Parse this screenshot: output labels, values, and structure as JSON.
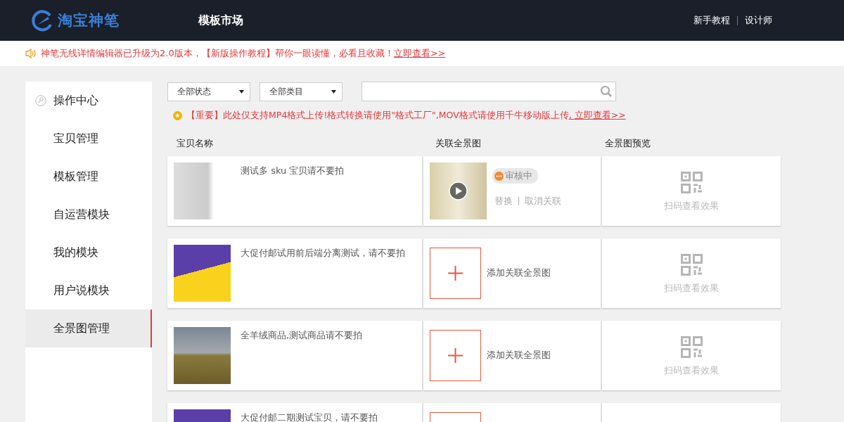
{
  "header": {
    "logo_text": "淘宝神笔",
    "title": "模板市场",
    "links": [
      "新手教程",
      "设计师"
    ]
  },
  "notice": {
    "text": "神笔无线详情编辑器已升级为2.0版本，【新版操作教程】帮你一眼读懂，必看且收藏！",
    "link": "立即查看>>"
  },
  "sidebar": {
    "items": [
      {
        "label": "操作中心",
        "kind": "with-icon",
        "selected": false
      },
      {
        "label": "宝贝管理",
        "kind": "plain",
        "selected": false
      },
      {
        "label": "模板管理",
        "kind": "plain",
        "selected": false
      },
      {
        "label": "自运营模块",
        "kind": "plain",
        "selected": false
      },
      {
        "label": "我的模块",
        "kind": "plain",
        "selected": false
      },
      {
        "label": "用户说模块",
        "kind": "plain",
        "selected": false
      },
      {
        "label": "全景图管理",
        "kind": "plain",
        "selected": true
      }
    ]
  },
  "filters": {
    "status": "全部状态",
    "category": "全部类目"
  },
  "warning": {
    "text": "【重要】此处仅支持MP4格式上传!格式转换请使用\"格式工厂\",MOV格式请使用千牛移动版上传",
    "link": ", 立即查看>>"
  },
  "table": {
    "columns": [
      "宝贝名称",
      "关联全景图",
      "全景图预览"
    ],
    "rows": [
      {
        "title": "测试多 sku 宝贝请不要拍",
        "thumbnail": {
          "kind": "document"
        },
        "kind": "linked",
        "status": "审核中",
        "actions": [
          "替换",
          "取消关联"
        ],
        "preview_label": "扫码查看效果"
      },
      {
        "title": "大促付邮试用前后端分离测试，请不要拍",
        "thumbnail": {
          "kind": "promo"
        },
        "kind": "unlinked",
        "add_label": "添加关联全景图",
        "preview_label": "扫码查看效果"
      },
      {
        "title": "全羊绒商品,测试商品请不要拍",
        "thumbnail": {
          "kind": "building"
        },
        "kind": "unlinked",
        "add_label": "添加关联全景图",
        "preview_label": "扫码查看效果"
      },
      {
        "title": "大促付邮二期测试宝贝，请不要拍",
        "thumbnail": {
          "kind": "promo"
        },
        "kind": "unlinked"
      }
    ]
  }
}
